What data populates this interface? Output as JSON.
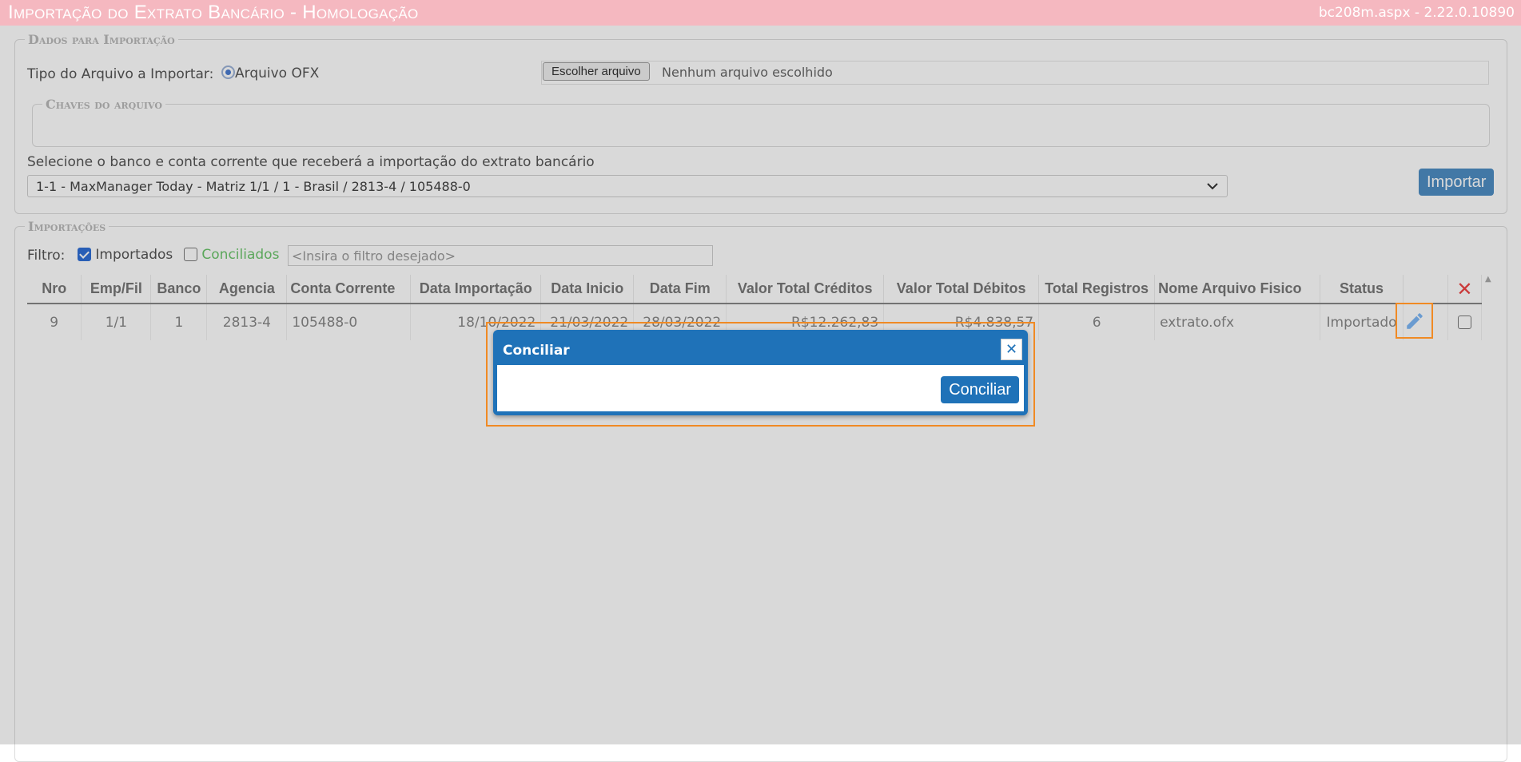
{
  "header": {
    "title": "Importação do Extrato Bancário  - Homologação",
    "version": "bc208m.aspx - 2.22.0.10890"
  },
  "dados": {
    "legend": "Dados para Importação",
    "tipo_label": "Tipo do Arquivo a Importar:",
    "radio_label": "Arquivo OFX",
    "file_button": "Escolher arquivo",
    "file_status": "Nenhum arquivo escolhido",
    "chaves_legend": "Chaves do arquivo",
    "select_label": "Selecione o banco e conta corrente que receberá a importação do extrato bancário",
    "select_value": "1-1 - MaxManager Today - Matriz 1/1 / 1 - Brasil / 2813-4 / 105488-0",
    "importar_button": "Importar"
  },
  "importacoes": {
    "legend": "Importações",
    "filtro_label": "Filtro:",
    "importados_label": "Importados",
    "importados_checked": true,
    "conciliados_label": "Conciliados",
    "conciliados_checked": false,
    "filter_placeholder": "<Insira o filtro desejado>"
  },
  "table": {
    "headers": {
      "nro": "Nro",
      "empfil": "Emp/Fil",
      "banco": "Banco",
      "agencia": "Agencia",
      "conta": "Conta Corrente",
      "data_imp": "Data Importação",
      "data_ini": "Data Inicio",
      "data_fim": "Data Fim",
      "credito": "Valor Total Créditos",
      "debito": "Valor Total Débitos",
      "total": "Total Registros",
      "arquivo": "Nome Arquivo Fisico",
      "status": "Status"
    },
    "rows": [
      {
        "nro": "9",
        "empfil": "1/1",
        "banco": "1",
        "agencia": "2813-4",
        "conta": "105488-0",
        "data_imp": "18/10/2022",
        "data_ini": "21/03/2022",
        "data_fim": "28/03/2022",
        "credito": "R$12.262,83",
        "debito": "-R$4.838,57",
        "total": "6",
        "arquivo": "extrato.ofx",
        "status": "Importado"
      }
    ]
  },
  "dialog": {
    "title": "Conciliar",
    "close_glyph": "✕",
    "button": "Conciliar"
  },
  "colors": {
    "titlebar": "#f5b8c0",
    "dialog": "#1f72b8",
    "highlight": "#f08a24",
    "debit": "#e05a4a",
    "conciliados": "#6cc56c"
  }
}
